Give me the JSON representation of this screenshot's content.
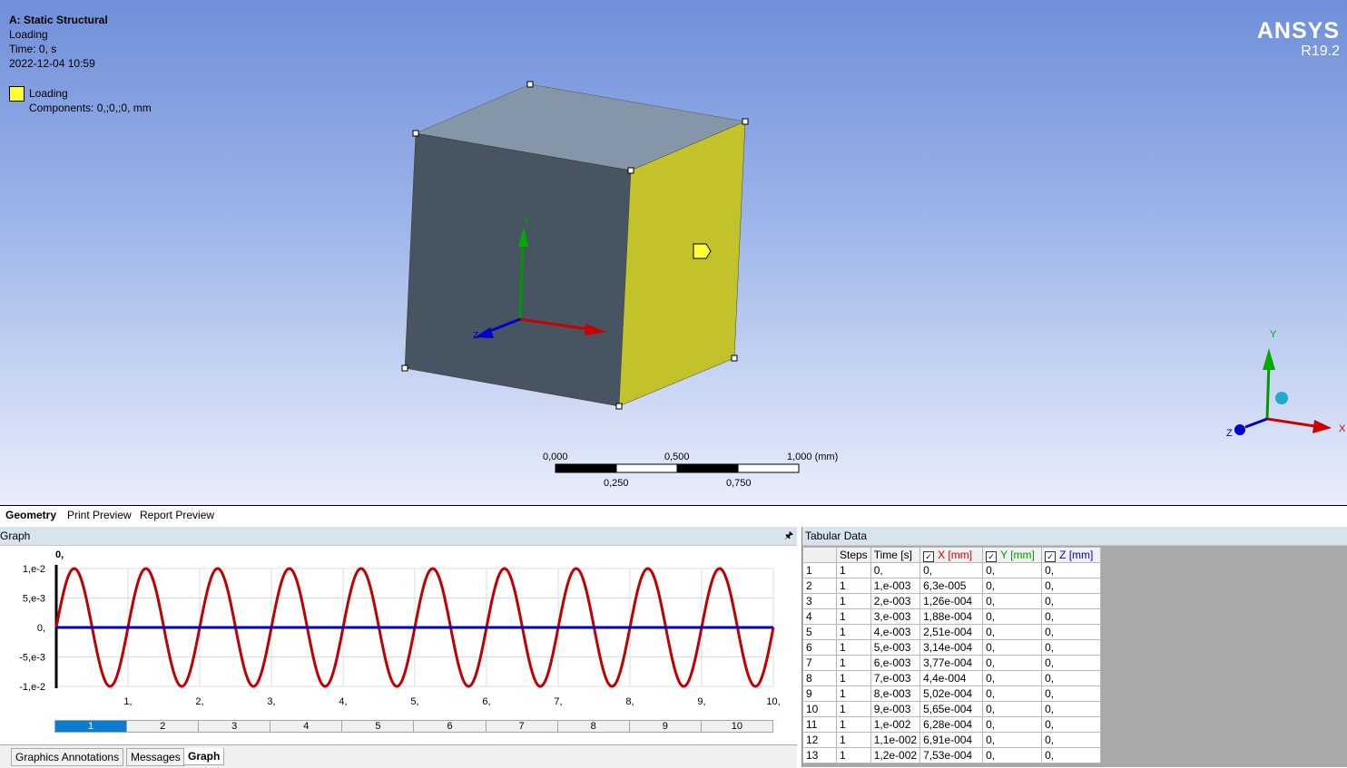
{
  "viewport": {
    "title": "A: Static Structural",
    "lines": [
      "Loading",
      "Time: 0, s",
      "2022-12-04 10:59"
    ],
    "legend_label": "Loading",
    "legend_detail": "Components: 0,;0,;0, mm",
    "legend_color": "#ffff33",
    "brand": "ANSYS",
    "version": "R19.2",
    "triad_labels": {
      "x": "X",
      "y": "Y",
      "z": "Z"
    },
    "scale": {
      "top": [
        "0,000",
        "0,500",
        "1,000 (mm)"
      ],
      "bottom": [
        "0,250",
        "0,750"
      ]
    }
  },
  "view_tabs": [
    "Geometry",
    "Print Preview",
    "Report Preview"
  ],
  "graph": {
    "title": "Graph",
    "pin_icon": "pin-icon",
    "bottom_tabs": [
      "Graphics Annotations",
      "Messages",
      "Graph"
    ],
    "steps": [
      "1",
      "2",
      "3",
      "4",
      "5",
      "6",
      "7",
      "8",
      "9",
      "10"
    ]
  },
  "chart_data": {
    "type": "line",
    "title": "0,",
    "ytick_labels": [
      "1,e-2",
      "5,e-3",
      "0,",
      "-5,e-3",
      "-1,e-2"
    ],
    "yticks": [
      0.01,
      0.005,
      0,
      -0.005,
      -0.01
    ],
    "xtick_labels": [
      "1,",
      "2,",
      "3,",
      "4,",
      "5,",
      "6,",
      "7,",
      "8,",
      "9,",
      "10,"
    ],
    "xticks": [
      1,
      2,
      3,
      4,
      5,
      6,
      7,
      8,
      9,
      10
    ],
    "xlim": [
      0,
      10
    ],
    "ylim": [
      -0.01,
      0.01
    ],
    "series": [
      {
        "color": "#c00000",
        "function": "sine",
        "amplitude": 0.01,
        "cycles": 10
      },
      {
        "color": "#0000c0",
        "values_constant": 0
      }
    ]
  },
  "tabular": {
    "title": "Tabular Data",
    "headers": [
      "",
      "Steps",
      "Time [s]",
      "X [mm]",
      "Y [mm]",
      "Z [mm]"
    ],
    "rows": [
      [
        "1",
        "1",
        "0,",
        "0,",
        "0,",
        "0,"
      ],
      [
        "2",
        "1",
        "1,e-003",
        "6,3e-005",
        "0,",
        "0,"
      ],
      [
        "3",
        "1",
        "2,e-003",
        "1,26e-004",
        "0,",
        "0,"
      ],
      [
        "4",
        "1",
        "3,e-003",
        "1,88e-004",
        "0,",
        "0,"
      ],
      [
        "5",
        "1",
        "4,e-003",
        "2,51e-004",
        "0,",
        "0,"
      ],
      [
        "6",
        "1",
        "5,e-003",
        "3,14e-004",
        "0,",
        "0,"
      ],
      [
        "7",
        "1",
        "6,e-003",
        "3,77e-004",
        "0,",
        "0,"
      ],
      [
        "8",
        "1",
        "7,e-003",
        "4,4e-004",
        "0,",
        "0,"
      ],
      [
        "9",
        "1",
        "8,e-003",
        "5,02e-004",
        "0,",
        "0,"
      ],
      [
        "10",
        "1",
        "9,e-003",
        "5,65e-004",
        "0,",
        "0,"
      ],
      [
        "11",
        "1",
        "1,e-002",
        "6,28e-004",
        "0,",
        "0,"
      ],
      [
        "12",
        "1",
        "1,1e-002",
        "6,91e-004",
        "0,",
        "0,"
      ],
      [
        "13",
        "1",
        "1,2e-002",
        "7,53e-004",
        "0,",
        "0,"
      ]
    ]
  }
}
